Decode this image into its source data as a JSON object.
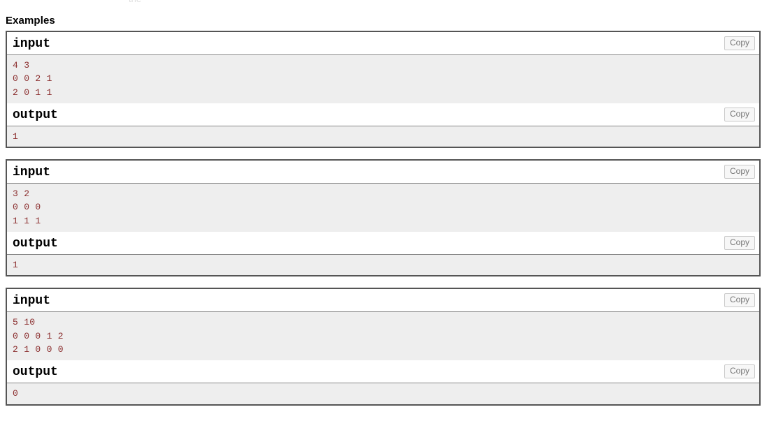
{
  "page": {
    "clipped_top_fragment": "the",
    "section_title": "Examples"
  },
  "labels": {
    "input": "input",
    "output": "output",
    "copy": "Copy"
  },
  "colors": {
    "data_text": "#8b2e2e",
    "data_background": "#eeeeee",
    "box_border": "#555555",
    "copy_text": "#777777"
  },
  "examples": [
    {
      "input_label": "input",
      "input_text": "4 3\n0 0 2 1\n2 0 1 1",
      "output_label": "output",
      "output_text": "1",
      "copy_input_label": "Copy",
      "copy_output_label": "Copy"
    },
    {
      "input_label": "input",
      "input_text": "3 2\n0 0 0\n1 1 1",
      "output_label": "output",
      "output_text": "1",
      "copy_input_label": "Copy",
      "copy_output_label": "Copy"
    },
    {
      "input_label": "input",
      "input_text": "5 10\n0 0 0 1 2\n2 1 0 0 0",
      "output_label": "output",
      "output_text": "0",
      "copy_input_label": "Copy",
      "copy_output_label": "Copy"
    }
  ]
}
